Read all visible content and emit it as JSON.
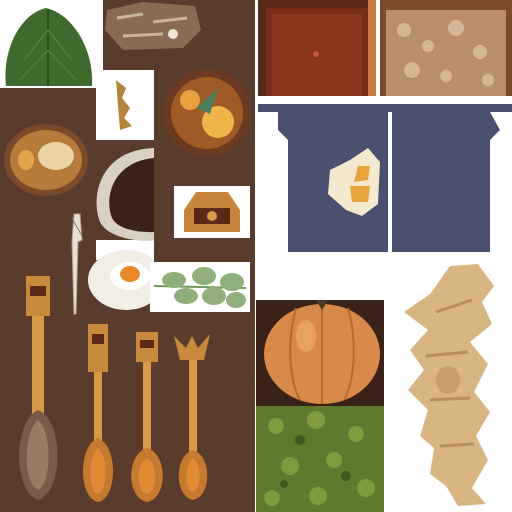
{
  "atlas": {
    "background": "#ffffff",
    "panel_color": "#5a3c2c",
    "sprites": [
      "leaf",
      "bark-chunk",
      "wooden-door",
      "stone-wall-panel",
      "small-key-charm",
      "glowing-lantern-orb",
      "tea-cup",
      "ceramic-bowl",
      "noren-curtain",
      "wooden-box",
      "whisk",
      "fried-egg-plate",
      "green-herb-sprig",
      "large-wooden-spoon",
      "medium-wooden-spoon",
      "small-wooden-spoon",
      "ornate-spoon",
      "pumpkin",
      "moss-patch",
      "ginger-root"
    ]
  },
  "colors": {
    "brown_panel": "#5a3c2c",
    "wood": "#c78a3a",
    "curtain": "#4a5170",
    "pumpkin": "#d98a4a",
    "moss": "#5d7a2f",
    "leaf": "#3e6b2d",
    "ginger": "#d9b584"
  }
}
